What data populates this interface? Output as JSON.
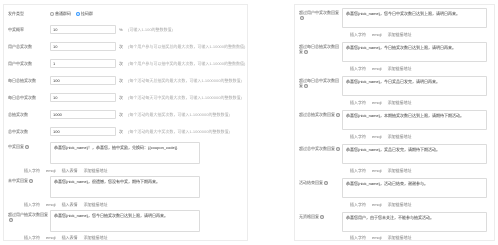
{
  "left": {
    "send_type": {
      "label": "发件类型",
      "options": [
        "普通群码",
        "挂码群"
      ],
      "selected": 1
    },
    "fields": [
      {
        "label": "中奖概率",
        "value": "10",
        "unit": "%",
        "hint": "(可输入1-100的整数数值)"
      },
      {
        "label": "用户总奖次数",
        "value": "10",
        "unit": "次",
        "hint": "(每个用户参与可以抽奖总的最大次数，可输入1-10000的整数数值)"
      },
      {
        "label": "用户中奖次数",
        "value": "1",
        "unit": "次",
        "hint": "(每个用户参与可以抽中奖的最大次数，可输入1-10000的整数数值)"
      },
      {
        "label": "每日总抽奖次数",
        "value": "100",
        "unit": "次",
        "hint": "(每个活动每天总抽奖的最大次数，可输入1-1000000的整数数值)"
      },
      {
        "label": "每日总中奖次数",
        "value": "10",
        "unit": "次",
        "hint": "(每个活动每天可中奖的最大次数，可输入1-1000000的整数数值)"
      },
      {
        "label": "总抽奖次数",
        "value": "1000",
        "unit": "次",
        "hint": "(每个活动的最大抽奖次数，可输入1-1000000的整数数值)"
      },
      {
        "label": "总中奖次数",
        "value": "100",
        "unit": "次",
        "hint": "(每个活动的最大中奖次数，可输入1-1000000的整数数值)"
      }
    ],
    "replies": [
      {
        "label": "中奖回复",
        "text": "恭喜您{nick_name}！，恭喜您，抽中奖励，兑换码：{{coupon_code}}"
      },
      {
        "label": "未中奖回复",
        "text": "恭喜您{nick_name}，很遗憾，您没有中奖，期待下期再来。"
      },
      {
        "label": "超过用户抽奖次数回复",
        "text": "恭喜您{nick_name}，您今日抽奖次数已达到上限，请明日再来。"
      }
    ],
    "tools": [
      "插入字符",
      "emoji",
      "插入表情",
      "添加链接地址"
    ]
  },
  "right": {
    "replies": [
      {
        "label": "超过用户中奖次数回复",
        "text": "恭喜您{nick_name}，您今日中奖次数已达到上限，请明日再来。"
      },
      {
        "label": "超过每日总抽奖次数回复",
        "text": "恭喜您{nick_name}，今日抽奖次数已达到上限，请明日再来。"
      },
      {
        "label": "超过每日总中奖次数回复",
        "text": "恭喜您{nick_name}，今日奖品已发完，请明日再来。"
      },
      {
        "label": "超过总抽奖次数回复",
        "text": "恭喜您{nick_name}，本期抽奖次数已达到上限，请期待下期活动。"
      },
      {
        "label": "超过总中奖次数回复",
        "text": "恭喜您{nick_name}，奖品已发完，请期待下期活动。"
      },
      {
        "label": "活动结束回复",
        "text": "恭喜您{nick_name}，活动已结束，谢谢参与。"
      },
      {
        "label": "无资格回复",
        "text": "恭喜您用户，由于您未关注，不能参与抽奖活动。"
      }
    ],
    "tools": [
      "插入字符",
      "emoji",
      "添加链接地址"
    ]
  }
}
